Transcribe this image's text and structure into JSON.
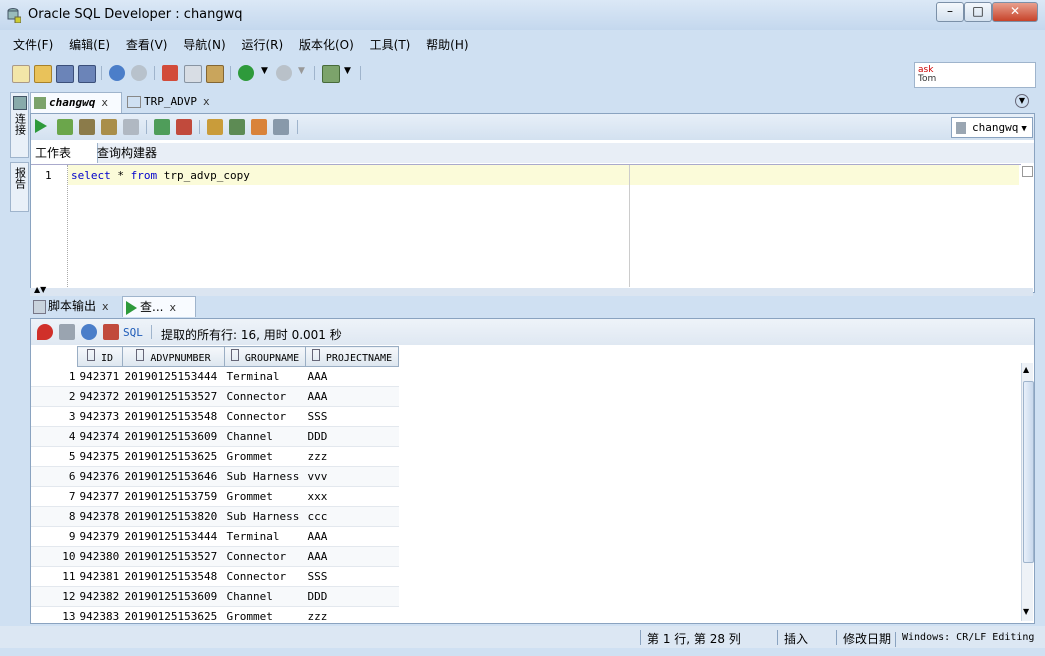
{
  "window": {
    "title": "Oracle SQL Developer : changwq",
    "min": "–",
    "max": "□",
    "close": "✕"
  },
  "menu": [
    "文件(F)",
    "编辑(E)",
    "查看(V)",
    "导航(N)",
    "运行(R)",
    "版本化(O)",
    "工具(T)",
    "帮助(H)"
  ],
  "ask": {
    "label": "ask",
    "sub": "Tom"
  },
  "side_tabs": [
    "连接",
    "报告"
  ],
  "editor": {
    "tabs": [
      {
        "label": "changwq",
        "close": "x"
      },
      {
        "label": "TRP_ADVP",
        "close": "x"
      }
    ],
    "connection": "changwq",
    "subtabs": [
      "工作表",
      "查询构建器"
    ],
    "line_number": "1",
    "code": {
      "kw1": "select",
      "mid1": " * ",
      "kw2": "from",
      "rest": " trp_advp_copy"
    }
  },
  "results": {
    "tabs": [
      {
        "label": "脚本输出",
        "close": "x"
      },
      {
        "label": "查...",
        "close": "x"
      }
    ],
    "sql_label": "SQL",
    "fetch_info": "提取的所有行: 16, 用时 0.001 秒",
    "columns": [
      "ID",
      "ADVPNUMBER",
      "GROUPNAME",
      "PROJECTNAME"
    ],
    "rows": [
      [
        "1",
        "942371",
        "20190125153444",
        "Terminal",
        "AAA"
      ],
      [
        "2",
        "942372",
        "20190125153527",
        "Connector",
        "AAA"
      ],
      [
        "3",
        "942373",
        "20190125153548",
        "Connector",
        "SSS"
      ],
      [
        "4",
        "942374",
        "20190125153609",
        "Channel",
        "DDD"
      ],
      [
        "5",
        "942375",
        "20190125153625",
        "Grommet",
        "zzz"
      ],
      [
        "6",
        "942376",
        "20190125153646",
        "Sub Harness",
        "vvv"
      ],
      [
        "7",
        "942377",
        "20190125153759",
        "Grommet",
        "xxx"
      ],
      [
        "8",
        "942378",
        "20190125153820",
        "Sub Harness",
        "ccc"
      ],
      [
        "9",
        "942379",
        "20190125153444",
        "Terminal",
        "AAA"
      ],
      [
        "10",
        "942380",
        "20190125153527",
        "Connector",
        "AAA"
      ],
      [
        "11",
        "942381",
        "20190125153548",
        "Connector",
        "SSS"
      ],
      [
        "12",
        "942382",
        "20190125153609",
        "Channel",
        "DDD"
      ],
      [
        "13",
        "942383",
        "20190125153625",
        "Grommet",
        "zzz"
      ]
    ]
  },
  "status": {
    "position": "第 1 行, 第 28 列",
    "mode": "插入",
    "modified": "修改日期",
    "encoding": "Windows: CR/LF Editing"
  }
}
